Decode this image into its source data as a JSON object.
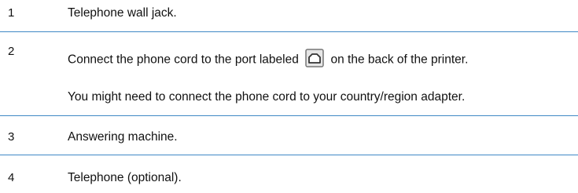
{
  "rows": [
    {
      "number": "1",
      "text": "Telephone wall jack."
    },
    {
      "number": "2",
      "text_before_icon": "Connect the phone cord to the port labeled",
      "icon": "phone-port-icon",
      "text_after_icon": "on the back of the printer.",
      "note": "You might need to connect the phone cord to your country/region adapter."
    },
    {
      "number": "3",
      "text": "Answering machine."
    },
    {
      "number": "4",
      "text": "Telephone (optional)."
    }
  ],
  "colors": {
    "separator": "#3f88c5",
    "text": "#111111",
    "icon_border": "#777777",
    "icon_fill": "#e6e6e6"
  }
}
